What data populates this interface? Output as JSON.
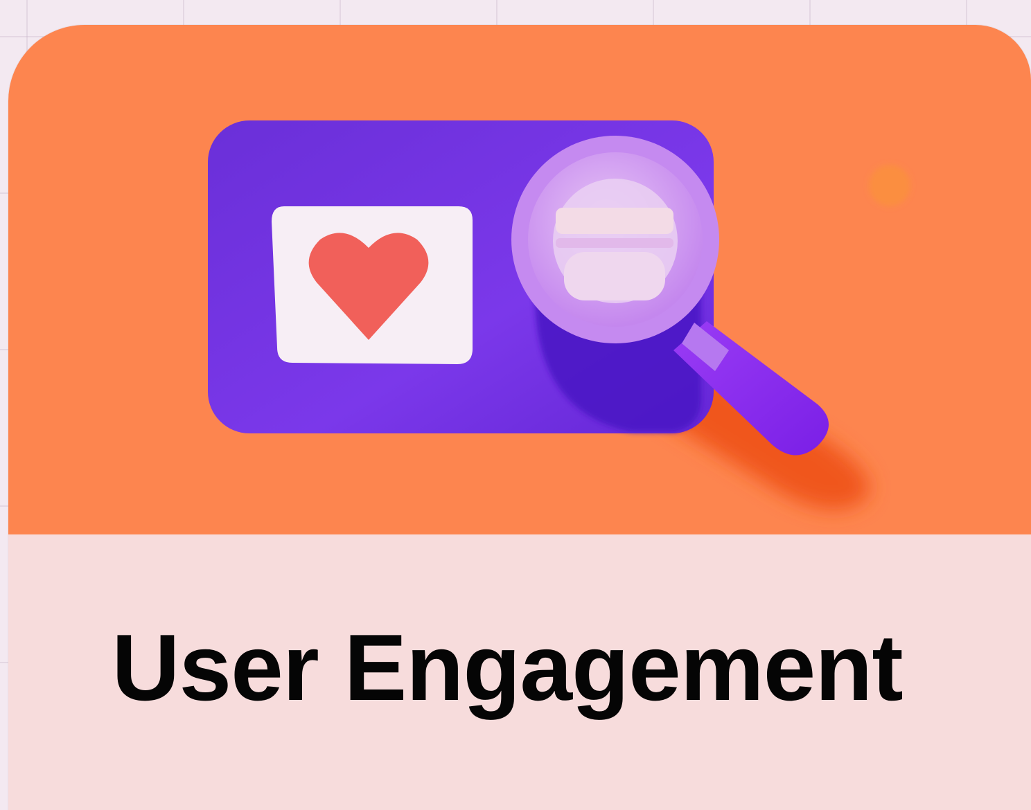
{
  "card": {
    "title": "User Engagement",
    "icon": "heart-magnifier-icon",
    "colors": {
      "top_background": "#fd854f",
      "bottom_background": "#f7dcdc",
      "panel": "#7a35e6",
      "heart": "#f1605a",
      "title_text": "#050505"
    }
  }
}
